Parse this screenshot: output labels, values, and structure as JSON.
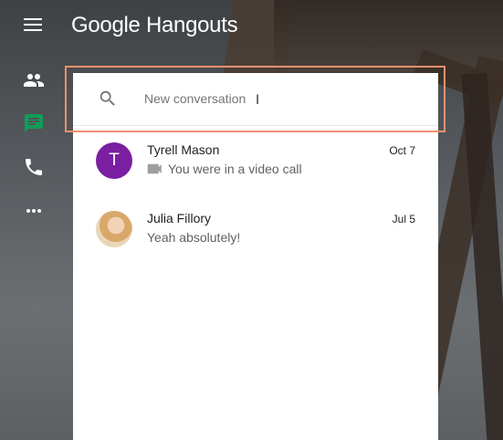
{
  "app": {
    "title": "Google Hangouts"
  },
  "icons": {
    "menu": "hamburger-menu-icon",
    "contacts": "people-icon",
    "messages": "chat-icon",
    "phone": "phone-icon",
    "more": "more-horizontal-icon",
    "search": "search-icon",
    "video": "videocam-icon"
  },
  "colors": {
    "active_nav": "#0f9d58",
    "avatar_tyrell": "#7b1fa2",
    "highlight": "#f2906e"
  },
  "search": {
    "placeholder": "New conversation"
  },
  "conversations": [
    {
      "initial": "T",
      "name": "Tyrell Mason",
      "date": "Oct 7",
      "preview": "You were in a video call"
    },
    {
      "initial": "",
      "name": "Julia Fillory",
      "date": "Jul 5",
      "preview": "Yeah absolutely!"
    }
  ]
}
